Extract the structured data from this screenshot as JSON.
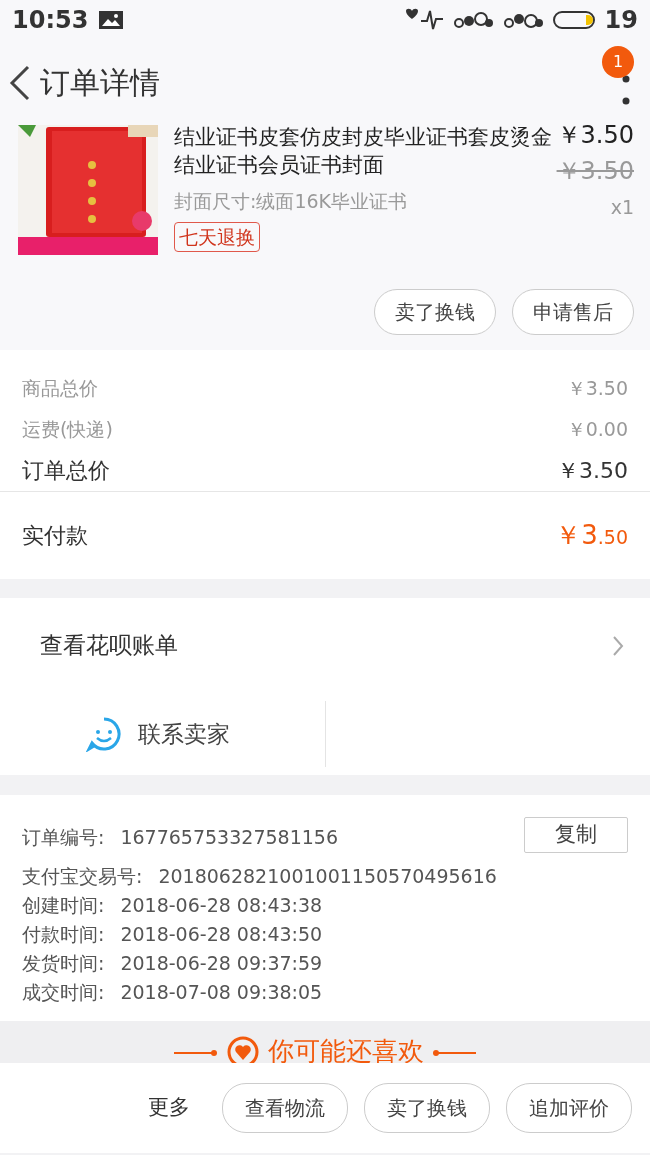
{
  "status_bar": {
    "time": "10:53",
    "battery_text": "19"
  },
  "header": {
    "title": "订单详情",
    "badge": "1"
  },
  "product": {
    "title": "结业证书皮套仿皮封皮毕业证书套皮烫金结业证书会员证书封面",
    "sku": "封面尺寸:绒面16K毕业证书",
    "tag": "七天退换",
    "price": "￥3.50",
    "original_price": "￥3.50",
    "quantity": "x1"
  },
  "product_actions": [
    "卖了换钱",
    "申请售后"
  ],
  "summary": {
    "rows": [
      {
        "label": "商品总价",
        "value": "￥3.50",
        "kind": "minor"
      },
      {
        "label": "运费(快递)",
        "value": "￥0.00",
        "kind": "minor"
      },
      {
        "label": "订单总价",
        "value": "￥3.50",
        "kind": "total"
      }
    ],
    "paid": {
      "label": "实付款",
      "value_integer": "￥3",
      "value_decimal": ".50"
    }
  },
  "huabei": {
    "label": "查看花呗账单"
  },
  "contact": {
    "label": "联系卖家"
  },
  "order_info": {
    "copy_button": "复制",
    "rows": [
      {
        "label": "订单编号:",
        "value": "167765753327581156"
      },
      {
        "label": "支付宝交易号:",
        "value": "2018062821001001150570495616"
      },
      {
        "label": "创建时间:",
        "value": "2018-06-28 08:43:38"
      },
      {
        "label": "付款时间:",
        "value": "2018-06-28 08:43:50"
      },
      {
        "label": "发货时间:",
        "value": "2018-06-28 09:37:59"
      },
      {
        "label": "成交时间:",
        "value": "2018-07-08 09:38:05"
      }
    ]
  },
  "recommend": {
    "title": "你可能还喜欢"
  },
  "bottom_bar": {
    "more": "更多",
    "buttons": [
      "查看物流",
      "卖了换钱",
      "追加评价"
    ]
  }
}
